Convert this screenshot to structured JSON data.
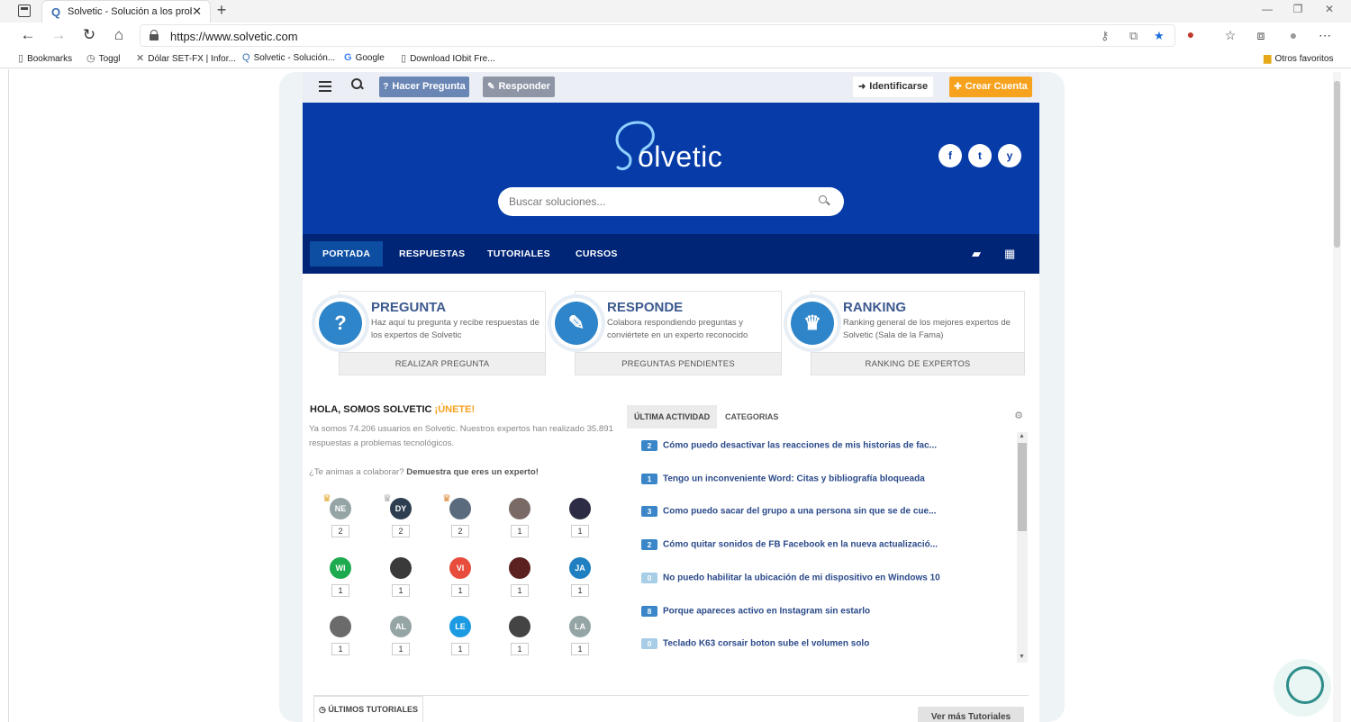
{
  "browser": {
    "tab_title": "Solvetic - Solución a los problem",
    "tab_close": "✕",
    "new_tab": "+",
    "url": "https://www.solvetic.com",
    "bookmarks": [
      {
        "label": "Bookmarks",
        "icon": "page-icon"
      },
      {
        "label": "Toggl",
        "icon": "clock-icon"
      },
      {
        "label": "Dólar SET-FX | Infor...",
        "icon": "chart-icon"
      },
      {
        "label": "Solvetic - Solución...",
        "icon": "solvetic-icon"
      },
      {
        "label": "Google",
        "icon": "google-icon"
      },
      {
        "label": "Download IObit Fre...",
        "icon": "page-icon"
      }
    ],
    "other_favorites": "Otros favoritos"
  },
  "topbar": {
    "ask_label": "Hacer Pregunta",
    "reply_label": "Responder",
    "login_label": "Identificarse",
    "signup_label": "Crear Cuenta"
  },
  "hero": {
    "logo_text": "olvetic",
    "search_placeholder": "Buscar soluciones...",
    "social": [
      "f",
      "t",
      "y"
    ]
  },
  "nav": {
    "items": [
      "PORTADA",
      "RESPUESTAS",
      "TUTORIALES",
      "CURSOS"
    ]
  },
  "cards": [
    {
      "title": "PREGUNTA",
      "desc": "Haz aquí tu pregunta y recibe respuestas de los expertos de Solvetic",
      "action": "REALIZAR PREGUNTA",
      "icon": "question-icon"
    },
    {
      "title": "RESPONDE",
      "desc": "Colabora respondiendo preguntas y conviértete en un experto reconocido",
      "action": "PREGUNTAS PENDIENTES",
      "icon": "pencil-icon"
    },
    {
      "title": "RANKING",
      "desc": "Ranking general de los mejores expertos de Solvetic (Sala de la Fama)",
      "action": "RANKING DE EXPERTOS",
      "icon": "trophy-icon"
    }
  ],
  "community": {
    "heading": "HOLA, SOMOS SOLVETIC",
    "join": "¡ÚNETE!",
    "intro": "Ya somos 74.206 usuarios en Solvetic. Nuestros expertos han realizado 35.891 respuestas a problemas tecnológicos.",
    "collab_q": "¿Te animas a colaborar?",
    "collab_cta": "Demuestra que eres un experto!",
    "users": [
      {
        "initials": "NE",
        "count": "2",
        "color": "#95a5a6",
        "trophy": "gold"
      },
      {
        "initials": "DY",
        "count": "2",
        "color": "#2c3e50",
        "trophy": "silver"
      },
      {
        "initials": "",
        "count": "2",
        "color": "#5a6b7d",
        "trophy": "bronze"
      },
      {
        "initials": "",
        "count": "1",
        "color": "#7a6a66",
        "trophy": ""
      },
      {
        "initials": "",
        "count": "1",
        "color": "#2c2c44",
        "trophy": ""
      },
      {
        "initials": "WI",
        "count": "1",
        "color": "#1eaa4e",
        "trophy": ""
      },
      {
        "initials": "",
        "count": "1",
        "color": "#3a3a3a",
        "trophy": ""
      },
      {
        "initials": "VI",
        "count": "1",
        "color": "#e74c3c",
        "trophy": ""
      },
      {
        "initials": "",
        "count": "1",
        "color": "#5b2020",
        "trophy": ""
      },
      {
        "initials": "JA",
        "count": "1",
        "color": "#1f7fc0",
        "trophy": ""
      },
      {
        "initials": "",
        "count": "1",
        "color": "#6b6b6b",
        "trophy": ""
      },
      {
        "initials": "AL",
        "count": "1",
        "color": "#95a5a6",
        "trophy": ""
      },
      {
        "initials": "LE",
        "count": "1",
        "color": "#1d9be2",
        "trophy": ""
      },
      {
        "initials": "",
        "count": "1",
        "color": "#444444",
        "trophy": ""
      },
      {
        "initials": "LA",
        "count": "1",
        "color": "#95a5a6",
        "trophy": ""
      }
    ]
  },
  "activity": {
    "tabs": [
      "ÚLTIMA ACTIVIDAD",
      "CATEGORIAS"
    ],
    "items": [
      {
        "count": "2",
        "title": "Cómo puedo desactivar las reacciones de mis historias de fac..."
      },
      {
        "count": "1",
        "title": "Tengo un inconveniente Word: Citas y bibliografía bloqueada"
      },
      {
        "count": "3",
        "title": "Como puedo sacar del grupo a una persona sin que se de cue..."
      },
      {
        "count": "2",
        "title": "Cómo quitar sonidos de FB Facebook en la nueva actualizació..."
      },
      {
        "count": "0",
        "title": "No puedo habilitar la ubicación de mi dispositivo en Windows 10"
      },
      {
        "count": "8",
        "title": "Porque apareces activo en Instagram sin estarlo"
      },
      {
        "count": "0",
        "title": "Teclado K63 corsair boton sube el volumen solo"
      }
    ]
  },
  "bottom": {
    "tutorials_tab": "ÚLTIMOS TUTORIALES",
    "more_button": "Ver más Tutoriales"
  },
  "colors": {
    "hero_blue": "#073ca8",
    "nav_blue": "#002577",
    "accent_orange": "#f7a21e",
    "link_blue": "#2b4a8a"
  }
}
